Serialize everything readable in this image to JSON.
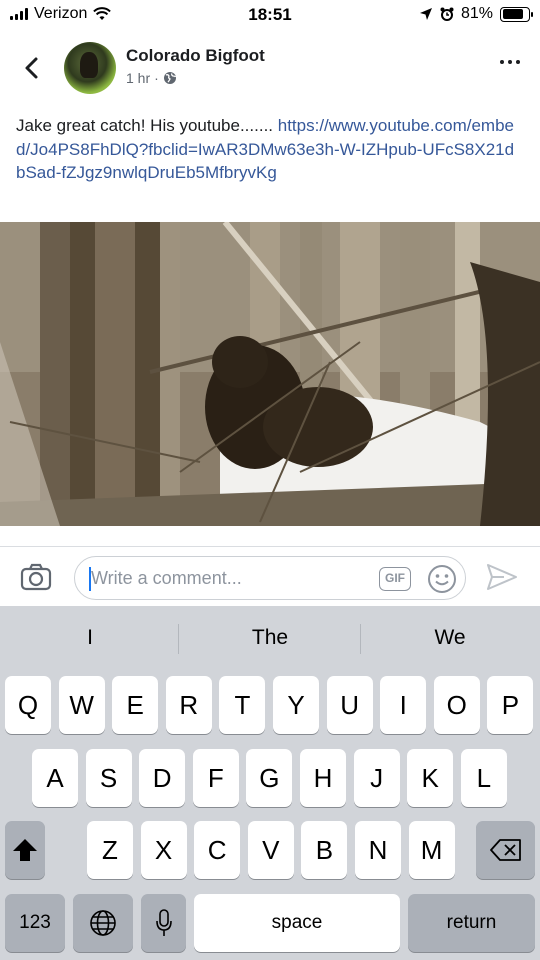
{
  "status_bar": {
    "carrier": "Verizon",
    "time": "18:51",
    "battery": "81%",
    "battery_level": 0.81
  },
  "post": {
    "page_name": "Colorado Bigfoot",
    "time_ago": "1 hr",
    "separator": "·",
    "text": "Jake great catch!  His youtube....... ",
    "link": "https://www.youtube.com/embed/Jo4PS8FhDlQ?fbclid=IwAR3DMw63e3h-W-IZHpub-UFcS8X21dbSad-fZJgz9nwlqDruEb5MfbryvKg"
  },
  "comment": {
    "placeholder": "Write a comment...",
    "gif_label": "GIF"
  },
  "keyboard": {
    "suggestions": [
      "I",
      "The",
      "We"
    ],
    "row1": [
      "Q",
      "W",
      "E",
      "R",
      "T",
      "Y",
      "U",
      "I",
      "O",
      "P"
    ],
    "row2": [
      "A",
      "S",
      "D",
      "F",
      "G",
      "H",
      "J",
      "K",
      "L"
    ],
    "row3": [
      "Z",
      "X",
      "C",
      "V",
      "B",
      "N",
      "M"
    ],
    "numbers_label": "123",
    "space_label": "space",
    "return_label": "return"
  },
  "icons": {
    "signal": "signal-bars-icon",
    "wifi": "wifi-icon",
    "location": "location-arrow-icon",
    "alarm": "alarm-icon",
    "back": "chevron-left-icon",
    "privacy": "globe-icon",
    "more": "more-horizontal-icon",
    "camera": "camera-icon",
    "emoji": "smiley-icon",
    "send": "send-icon",
    "shift": "shift-icon",
    "delete": "backspace-icon",
    "globe_key": "globe-icon",
    "dictation": "microphone-icon"
  }
}
